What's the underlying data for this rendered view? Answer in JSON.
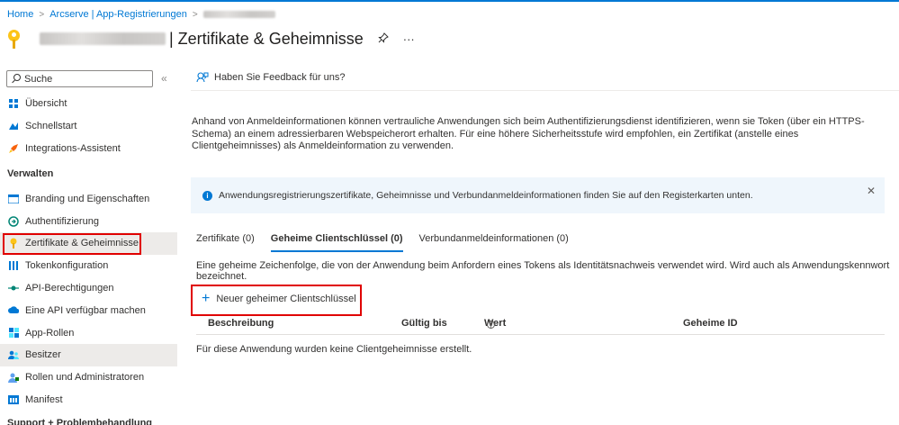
{
  "breadcrumb": {
    "home": "Home",
    "app_registrations": "Arcserve | App-Registrierungen"
  },
  "header": {
    "title": "| Zertifikate & Geheimnisse",
    "pin_glyph": "✎",
    "more_glyph": "···"
  },
  "sidebar": {
    "search_placeholder": "Suche",
    "collapse_glyph": "«",
    "items_top": [
      {
        "label": "Übersicht",
        "icon": "overview-icon"
      },
      {
        "label": "Schnellstart",
        "icon": "quickstart-icon"
      },
      {
        "label": "Integrations-Assistent",
        "icon": "rocket-icon"
      }
    ],
    "section_manage": "Verwalten",
    "items_manage": [
      {
        "label": "Branding und Eigenschaften",
        "icon": "branding-icon"
      },
      {
        "label": "Authentifizierung",
        "icon": "auth-icon"
      },
      {
        "label": "Zertifikate & Geheimnisse",
        "icon": "key-icon"
      },
      {
        "label": "Tokenkonfiguration",
        "icon": "token-icon"
      },
      {
        "label": "API-Berechtigungen",
        "icon": "api-permissions-icon"
      },
      {
        "label": "Eine API verfügbar machen",
        "icon": "cloud-icon"
      },
      {
        "label": "App-Rollen",
        "icon": "app-roles-icon"
      },
      {
        "label": "Besitzer",
        "icon": "owners-icon"
      },
      {
        "label": "Rollen und Administratoren",
        "icon": "roles-icon"
      },
      {
        "label": "Manifest",
        "icon": "manifest-icon"
      }
    ],
    "section_support": "Support + Problembehandlung"
  },
  "main": {
    "feedback_label": "Haben Sie Feedback für uns?",
    "description": "Anhand von Anmeldeinformationen können vertrauliche Anwendungen sich beim Authentifizierungsdienst identifizieren, wenn sie Token (über ein HTTPS-Schema) an einem adressierbaren Webspeicherort erhalten. Für eine höhere Sicherheitsstufe wird empfohlen, ein Zertifikat (anstelle eines Clientgeheimnisses) als Anmeldeinformation zu verwenden.",
    "info_text": "Anwendungsregistrierungszertifikate, Geheimnisse und Verbundanmeldeinformationen finden Sie auf den Registerkarten unten.",
    "tabs": [
      {
        "label": "Zertifikate (0)"
      },
      {
        "label": "Geheime Clientschlüssel (0)"
      },
      {
        "label": "Verbundanmeldeinformationen (0)"
      }
    ],
    "secret_description": "Eine geheime Zeichenfolge, die von der Anwendung beim Anfordern eines Tokens als Identitätsnachweis verwendet wird. Wird auch als Anwendungskennwort bezeichnet.",
    "new_secret_label": "Neuer geheimer Clientschlüssel",
    "columns": [
      "Beschreibung",
      "Gültig bis",
      "Wert",
      "Geheime ID"
    ],
    "empty_message": "Für diese Anwendung wurden keine Clientgeheimnisse erstellt."
  },
  "colors": {
    "accent": "#0078d4",
    "highlight_border": "#e00000",
    "info_background": "#eff6fc",
    "selected_nav": "#edebe9"
  }
}
